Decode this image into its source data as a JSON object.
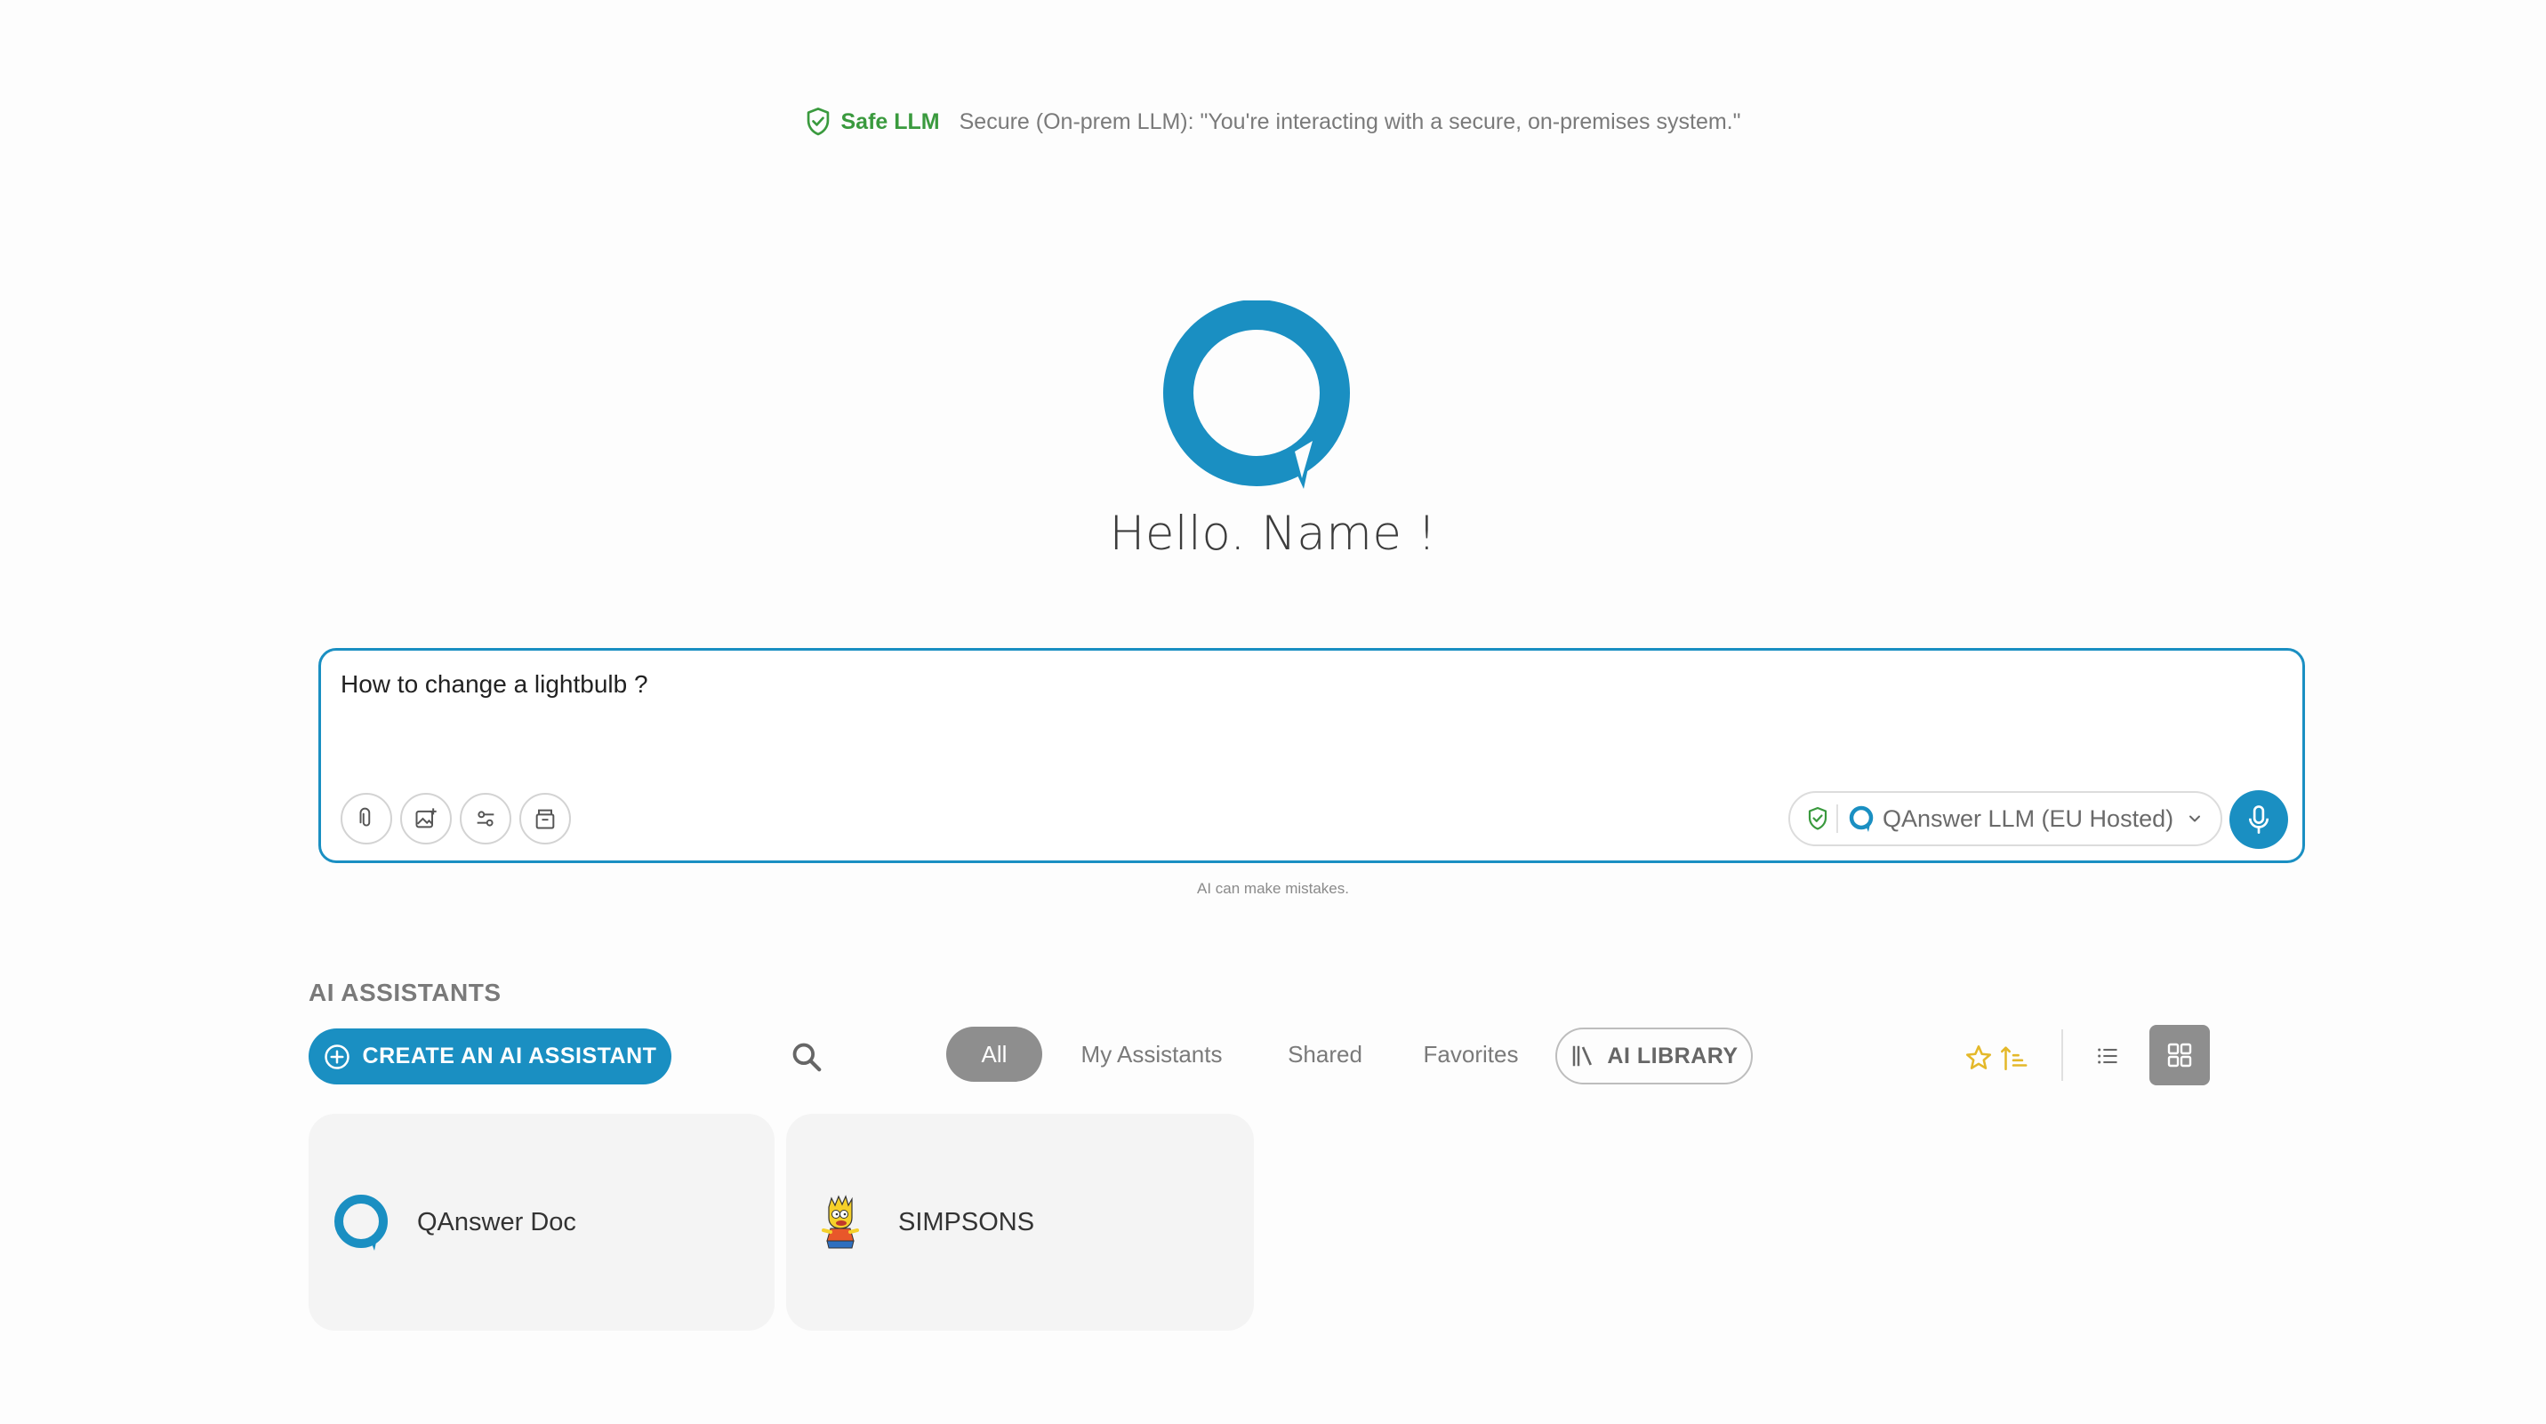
{
  "banner": {
    "safe_label": "Safe LLM",
    "message": "Secure (On-prem LLM): \"You're interacting with a secure, on-premises system.\""
  },
  "greeting": "Hello. Name !",
  "chat": {
    "input_value": "How to change a lightbulb ?",
    "model_label": "QAnswer LLM (EU Hosted)",
    "disclaimer": "AI can make mistakes."
  },
  "assistants": {
    "title": "AI ASSISTANTS",
    "create_label": "CREATE AN AI ASSISTANT",
    "filters": [
      "All",
      "My Assistants",
      "Shared",
      "Favorites"
    ],
    "selected_filter": "All",
    "library_label": "AI LIBRARY",
    "view_mode": "grid",
    "cards": [
      {
        "name": "QAnswer Doc",
        "icon": "qanswer-logo-icon"
      },
      {
        "name": "SIMPSONS",
        "icon": "simpsons-character-icon"
      }
    ]
  },
  "colors": {
    "accent": "#1a8fc2",
    "safe_green": "#3a9a3e",
    "star_yellow": "#e4b82a",
    "muted_gray": "#8e8e8e"
  }
}
